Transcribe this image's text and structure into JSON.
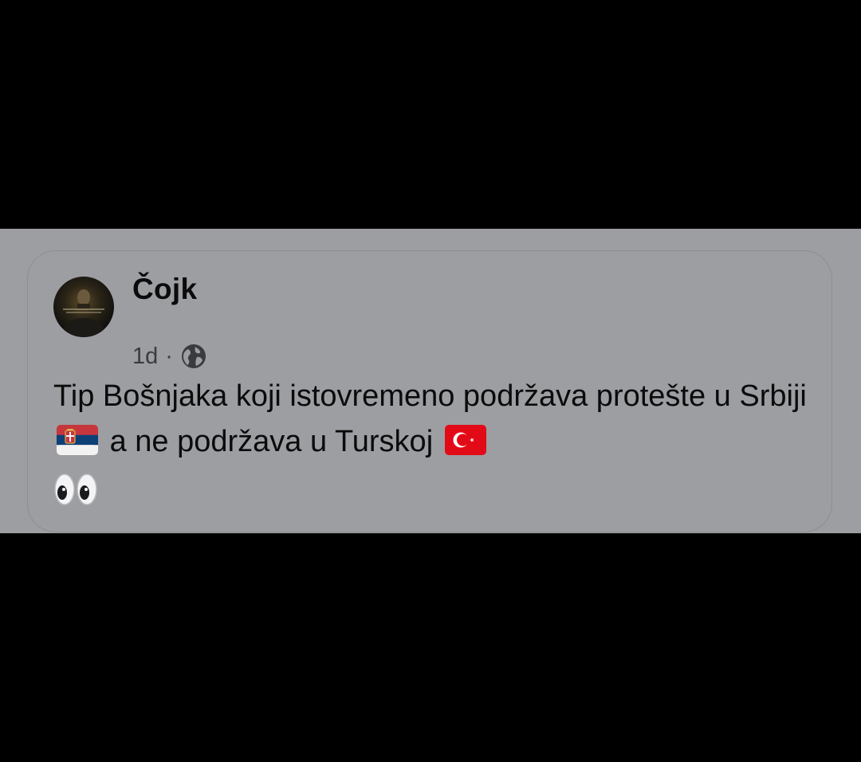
{
  "post": {
    "author": "Čojk",
    "time": "1d",
    "separator": "·",
    "audience_icon": "globe-icon",
    "text_part1": "Tip Bošnjaka koji istovremeno podržava protešte u Srbiji",
    "flag1_icon": "serbian-flag-icon",
    "text_part2": "a ne podržava u Turskoj",
    "flag2_icon": "turkish-flag-icon",
    "end_icon": "eyes-emoji-icon"
  },
  "colors": {
    "background": "#000000",
    "card": "#9d9ea2",
    "text": "#0b0b0c",
    "meta_text": "#3a3b3e"
  }
}
